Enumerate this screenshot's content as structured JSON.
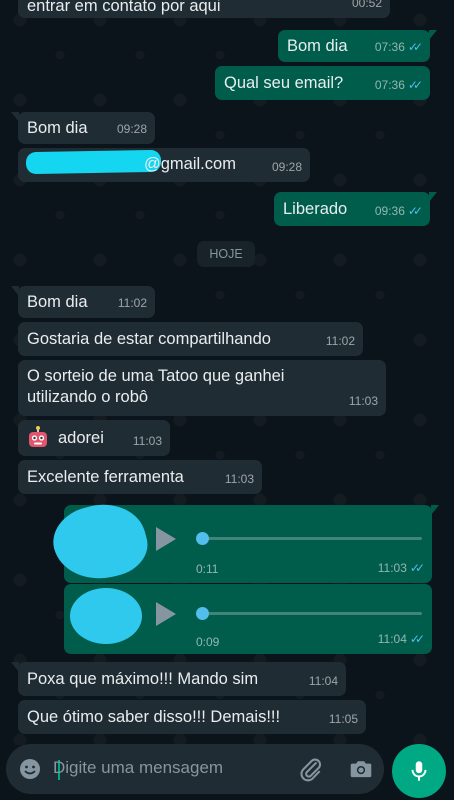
{
  "messages": {
    "m0": {
      "text": "entrar em contato por aqui",
      "time": "00:52"
    },
    "m1": {
      "text": "Bom dia",
      "time": "07:36"
    },
    "m2": {
      "text": "Qual seu email?",
      "time": "07:36"
    },
    "m3": {
      "text": "Bom dia",
      "time": "09:28"
    },
    "m4": {
      "text": "@gmail.com",
      "time": "09:28"
    },
    "m5": {
      "text": "Liberado",
      "time": "09:36"
    },
    "m6": {
      "text": "Bom dia",
      "time": "11:02"
    },
    "m7": {
      "text": "Gostaria de estar compartilhando",
      "time": "11:02"
    },
    "m8": {
      "text": "O sorteio de uma Tatoo que ganhei utilizando o robô",
      "time": "11:03"
    },
    "m9": {
      "text": "adorei",
      "time": "11:03"
    },
    "m10": {
      "text": "Excelente ferramenta",
      "time": "11:03"
    },
    "a1": {
      "duration": "0:11",
      "time": "11:03",
      "progress": 0
    },
    "a2": {
      "duration": "0:09",
      "time": "11:04",
      "progress": 0
    },
    "m11": {
      "text": "Poxa que máximo!!! Mando sim",
      "time": "11:04"
    },
    "m12": {
      "text": "Que ótimo saber disso!!! Demais!!!",
      "time": "11:05"
    }
  },
  "day_divider": "HOJE",
  "composer": {
    "placeholder": "Digite uma mensagem",
    "icons": [
      "emoji-icon",
      "attach-icon",
      "camera-icon",
      "mic-icon"
    ]
  },
  "colors": {
    "background": "#0b141a",
    "incoming": "#202c33",
    "outgoing": "#005c4b",
    "read_ticks": "#53bdeb",
    "accent": "#00a884"
  }
}
